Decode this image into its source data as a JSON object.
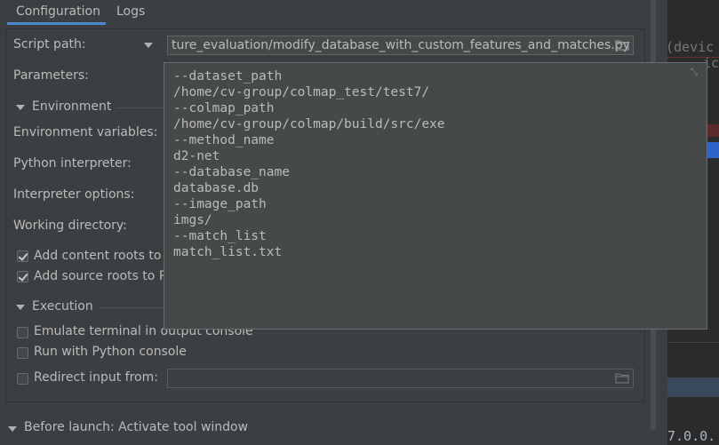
{
  "tabs": [
    {
      "label": "Configuration",
      "active": true
    },
    {
      "label": "Logs",
      "active": false
    }
  ],
  "form": {
    "script_path": {
      "label": "Script path:",
      "value": "ture_evaluation/modify_database_with_custom_features_and_matches.py"
    },
    "parameters_label": "Parameters:",
    "environment": {
      "section_label": "Environment",
      "env_vars_label": "Environment variables:",
      "python_interpreter_label": "Python interpreter:",
      "interpreter_options_label": "Interpreter options:",
      "working_directory_label": "Working directory:",
      "add_content_roots": {
        "label": "Add content roots to",
        "checked": true
      },
      "add_source_roots": {
        "label": "Add source roots to P",
        "checked": true
      }
    },
    "execution": {
      "section_label": "Execution",
      "emulate_terminal": {
        "label": "Emulate terminal in output console",
        "checked": false
      },
      "run_with_python_console": {
        "label": "Run with Python console",
        "checked": false
      },
      "redirect_input": {
        "label": "Redirect input from:",
        "checked": false,
        "value": ""
      }
    }
  },
  "parameters_popup": {
    "lines": [
      "--dataset_path",
      "/home/cv-group/colmap_test/test7/",
      "--colmap_path",
      "/home/cv-group/colmap/build/src/exe",
      "--method_name",
      "d2-net",
      "--database_name",
      "database.db",
      "--image_path",
      "imgs/",
      "--match_list",
      "match_list.txt"
    ],
    "expand_icon": "expand-collapse-icon"
  },
  "before_launch": {
    "label": "Before launch: Activate tool window"
  },
  "editor_snippets": {
    "top": "(devic",
    "line2": "ic",
    "bottom": "7.0.0."
  },
  "colors": {
    "accent": "#4a88c7",
    "background": "#3c3f41",
    "field_bg": "#45494a",
    "editor_bg": "#2b2b2b"
  }
}
